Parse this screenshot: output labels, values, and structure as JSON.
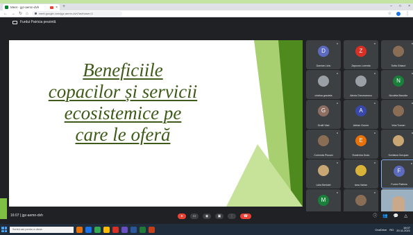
{
  "browser": {
    "tab_title": "Meet - jgz-aemn-dvh",
    "tab_close": "×",
    "new_tab": "+",
    "window_controls": [
      "–",
      "□",
      "×"
    ],
    "url": "meet.google.com/jgz-aemn-dvh?authuser=1",
    "nav": {
      "back": "←",
      "forward": "→",
      "reload": "↻",
      "home": "⌂"
    },
    "right_icons": [
      "☆",
      "⋮"
    ]
  },
  "meet": {
    "presenting_label": "Furdui Patricia prezintă",
    "slide": {
      "title_lines": [
        "Beneficiile",
        "copacilor și servicii",
        "ecosistemice pe",
        "care le oferă"
      ],
      "colors": {
        "title": "#3d5a18",
        "accent_light": "#a8d070",
        "accent_dark": "#4e8a1e"
      }
    },
    "participants": [
      {
        "name": "Damian Liviu",
        "initial": "D",
        "color": "#5c6bc0"
      },
      {
        "name": "Zapuran Lorentia",
        "initial": "Z",
        "color": "#d93025"
      },
      {
        "name": "Sofia Ghiauri",
        "photo": "photo"
      },
      {
        "name": "cristina graziela",
        "photo": "photo grey"
      },
      {
        "name": "Alexia Grecearenco",
        "photo": "photo grey"
      },
      {
        "name": "Nicoleta Bancilor",
        "initial": "N",
        "color": "#188038"
      },
      {
        "name": "Gratil Vlad",
        "initial": "G",
        "color": "#8d6e63"
      },
      {
        "name": "Adrian Gruner",
        "initial": "A",
        "color": "#3949ab"
      },
      {
        "name": "Irina Turcan",
        "photo": "photo"
      },
      {
        "name": "Corinnda Piscani",
        "photo": "photo"
      },
      {
        "name": "Ecaterina Dodu",
        "initial": "E",
        "color": "#e8710a"
      },
      {
        "name": "Svetlana Gorupan",
        "photo": "photo tan"
      },
      {
        "name": "Lidia Bertolet",
        "photo": "photo tan"
      },
      {
        "name": "Iana Varlan",
        "photo": "photo yellow"
      },
      {
        "name": "Furdui Patricia",
        "initial": "F",
        "color": "#5c6bc0",
        "active": true
      },
      {
        "name": "Montenegro Nicolae",
        "initial": "M",
        "color": "#188038"
      },
      {
        "name": "Vocii 16",
        "photo": "photo"
      },
      {
        "name": "",
        "video": true
      }
    ]
  },
  "controls": {
    "time": "16:07",
    "separator": "|",
    "meeting_code": "jgz-aemn-dvh",
    "buttons": [
      "●",
      "▭",
      "◉",
      "▣",
      "⋮"
    ],
    "hangup": "☎",
    "right": [
      "ⓘ",
      "👥",
      "💬",
      "△"
    ]
  },
  "taskbar": {
    "search_placeholder": "Scrieți aici pentru a căuta",
    "app_colors": [
      "#e8710a",
      "#1a73e8",
      "#34a853",
      "#fbbc04",
      "#d93025",
      "#6a4fc2",
      "#2b579a",
      "#1f7a3a",
      "#c43e1c"
    ],
    "tray_text": "OneDrive",
    "time": "16:07",
    "date": "20.11.2021",
    "lang": "RO"
  }
}
